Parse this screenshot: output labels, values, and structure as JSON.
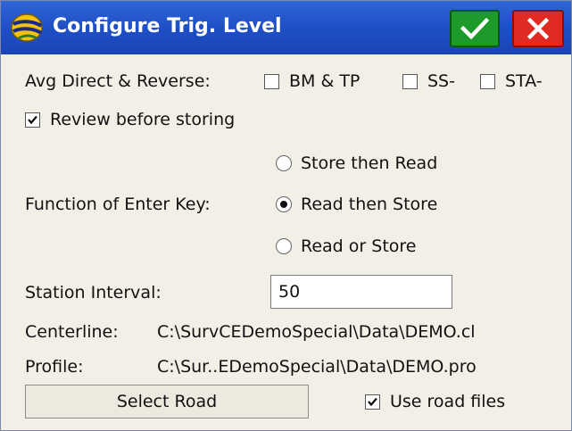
{
  "window": {
    "title": "Configure Trig. Level",
    "ok_icon": "checkmark-icon",
    "close_icon": "close-icon"
  },
  "avg": {
    "label": "Avg Direct & Reverse:",
    "options": [
      {
        "label": "BM & TP",
        "checked": false
      },
      {
        "label": "SS-",
        "checked": false
      },
      {
        "label": "STA-",
        "checked": false
      }
    ]
  },
  "review": {
    "label": "Review before storing",
    "checked": true
  },
  "enter_key": {
    "label": "Function of Enter Key:",
    "options": [
      {
        "label": "Store then Read",
        "selected": false
      },
      {
        "label": "Read then Store",
        "selected": true
      },
      {
        "label": "Read or Store",
        "selected": false
      }
    ]
  },
  "station_interval": {
    "label": "Station Interval:",
    "value": "50"
  },
  "centerline": {
    "label": "Centerline:",
    "value": "C:\\SurvCEDemoSpecial\\Data\\DEMO.cl"
  },
  "profile": {
    "label": "Profile:",
    "value": "C:\\Sur..EDemoSpecial\\Data\\DEMO.pro"
  },
  "select_road": {
    "label": "Select Road"
  },
  "use_road_files": {
    "label": "Use road files",
    "checked": true
  }
}
